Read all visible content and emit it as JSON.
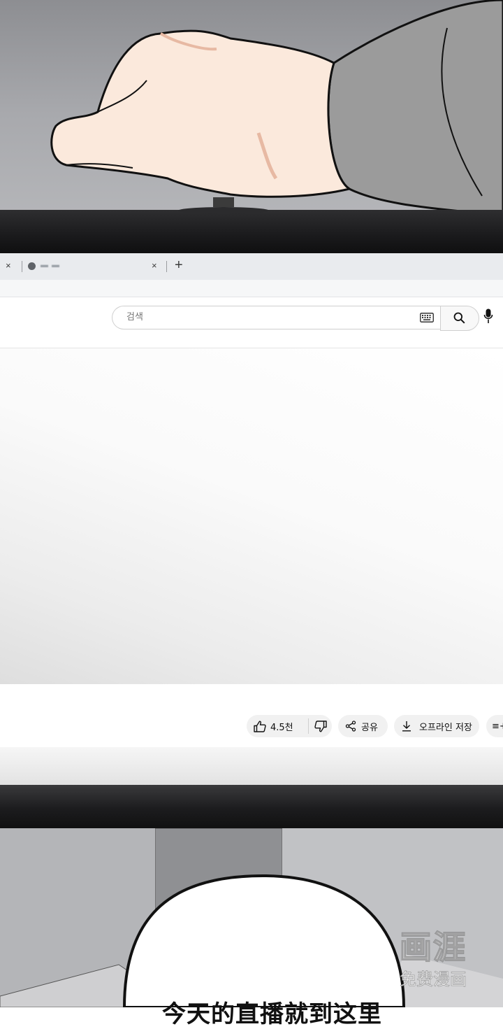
{
  "browser": {
    "tabs": [
      {
        "title": "",
        "favicon": "youtube-favicon"
      },
      {
        "title": "▬ ▬",
        "favicon": "youtube-favicon"
      }
    ],
    "close_symbol": "×",
    "new_tab_symbol": "+"
  },
  "header": {
    "search": {
      "placeholder": "검색",
      "value": ""
    },
    "icons": [
      "keyboard-icon",
      "search-icon",
      "mic-icon"
    ]
  },
  "actions": {
    "like_count": "4.5천",
    "share_label": "공유",
    "download_label": "오프라인 저장",
    "save_label": "≡+"
  },
  "comic": {
    "speech_bubble_text": "今天的直播就到这里",
    "watermark_brand": "画涯",
    "watermark_sub": "免费漫画"
  },
  "colors": {
    "panel_gray": "#a9aaad",
    "bezel": "#1a1a1c",
    "pill_bg": "#f1f1f1",
    "sleeve": "#9b9b9b",
    "skin": "#fbe9dc"
  }
}
